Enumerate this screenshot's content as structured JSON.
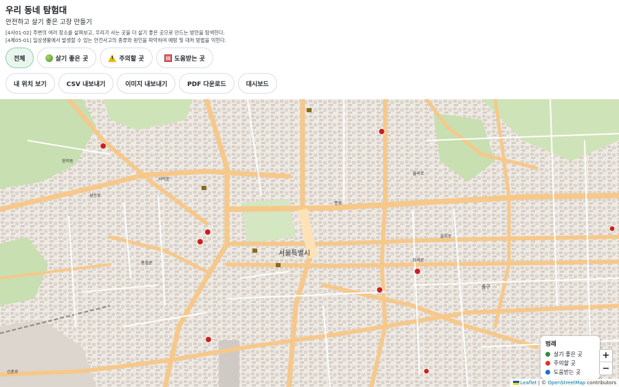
{
  "header": {
    "title": "우리 동네 탐험대",
    "subtitle": "안전하고 살기 좋은 고장 만들기",
    "standards": [
      "[4사01-02] 주변의 여러 장소를 살펴보고, 우리가 사는 곳을 더 살기 좋은 곳으로 만드는 방안을 탐색한다.",
      "[4체05-01] 일상생활에서 발생할 수 있는 안전사고의 종류와 원인을 파악하여 예방 및 대처 방법을 익힌다."
    ]
  },
  "filters": [
    {
      "label": "전체",
      "icon": "",
      "active": true
    },
    {
      "label": "살기 좋은 곳",
      "icon": "green-apple-icon",
      "active": false
    },
    {
      "label": "주의할 곳",
      "icon": "warning-icon",
      "active": false
    },
    {
      "label": "도움받는 곳",
      "icon": "building-icon",
      "active": false
    }
  ],
  "actions": [
    {
      "label": "내 위치 보기"
    },
    {
      "label": "CSV 내보내기"
    },
    {
      "label": "이미지 내보내기"
    },
    {
      "label": "PDF 다운로드"
    },
    {
      "label": "대시보드"
    }
  ],
  "map": {
    "labels": {
      "city_hall": "서울특별시",
      "jongno": "종로",
      "euljiro": "을지로",
      "toegye": "퇴계로",
      "sajik": "사직로",
      "chungjeong": "충정로",
      "sinchon": "신촌로",
      "seongsan": "성산로",
      "hyeonjeo": "현저동",
      "junggu": "중구",
      "yulgok": "율곡로"
    },
    "markers": {
      "hospital_count": 9,
      "heritage_count": 4
    }
  },
  "legend": {
    "title": "범례",
    "items": [
      {
        "label": "살기 좋은 곳",
        "color": "#2e8b3e"
      },
      {
        "label": "주의할 곳",
        "color": "#d9342b"
      },
      {
        "label": "도움받는 곳",
        "color": "#1f6fd1"
      }
    ]
  },
  "zoom": {
    "in": "+",
    "out": "−"
  },
  "attribution": {
    "leaflet": "Leaflet",
    "separator": "| ©",
    "osm": "OpenStreetMap",
    "suffix": "contributors"
  }
}
